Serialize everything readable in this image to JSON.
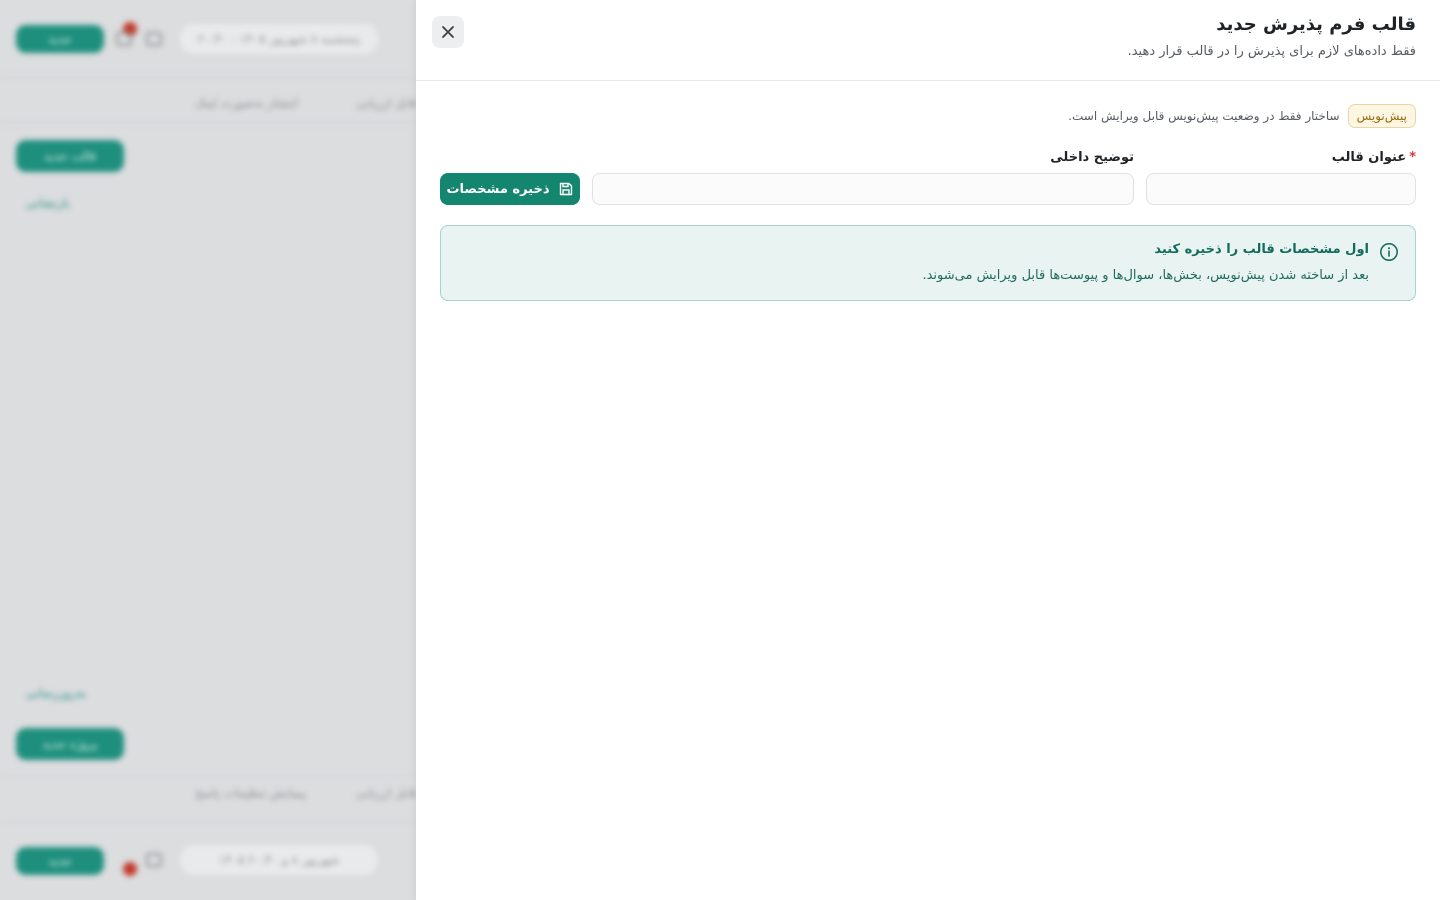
{
  "background": {
    "date_chip": "پنجشنبه ۸ شهریور ۱۴۰۵ - ۲۰:۴۰",
    "new_button": "جدید",
    "notification_count": "۲",
    "share_link": "انتشار به‌صورت لینک",
    "tab_partial": "قابل ارزیابی",
    "new_template_button": "قالب جدید",
    "reset_link": "بازنشانی",
    "refresh_link": "به‌روزرسانی",
    "new_item_button": "پروژه جدید",
    "share_settings": "پیمایش تنظیمات پاسخ",
    "tab_partial_2": "قابل ارزیابی",
    "footer_chip": "۱۴۰۵ شهریور ۸ و ۲۰:۴۰",
    "footer_button": "جدید"
  },
  "drawer": {
    "title": "قالب فرم پذیرش جدید",
    "subtitle": "فقط داده‌های لازم برای پذیرش را در قالب قرار دهید.",
    "close_icon": "close-icon",
    "status_badge": "پیش‌نویس",
    "status_text": "ساختار فقط در وضعیت پیش‌نویس قابل ویرایش است.",
    "fields": {
      "title_label": "عنوان قالب",
      "title_value": "",
      "description_label": "توضیح داخلی",
      "description_value": ""
    },
    "save_button": "ذخیره مشخصات",
    "save_icon": "save-icon",
    "info": {
      "icon": "info-icon",
      "title": "اول مشخصات قالب را ذخیره کنید",
      "body": "بعد از ساخته شدن پیش‌نویس، بخش‌ها، سوال‌ها و پیوست‌ها قابل ویرایش می‌شوند."
    }
  },
  "colors": {
    "accent": "#14866f",
    "info_bg": "#e8f3f2",
    "info_border": "#a7d4c8",
    "badge_bg": "#fdf6e3",
    "required": "#d9363e"
  }
}
